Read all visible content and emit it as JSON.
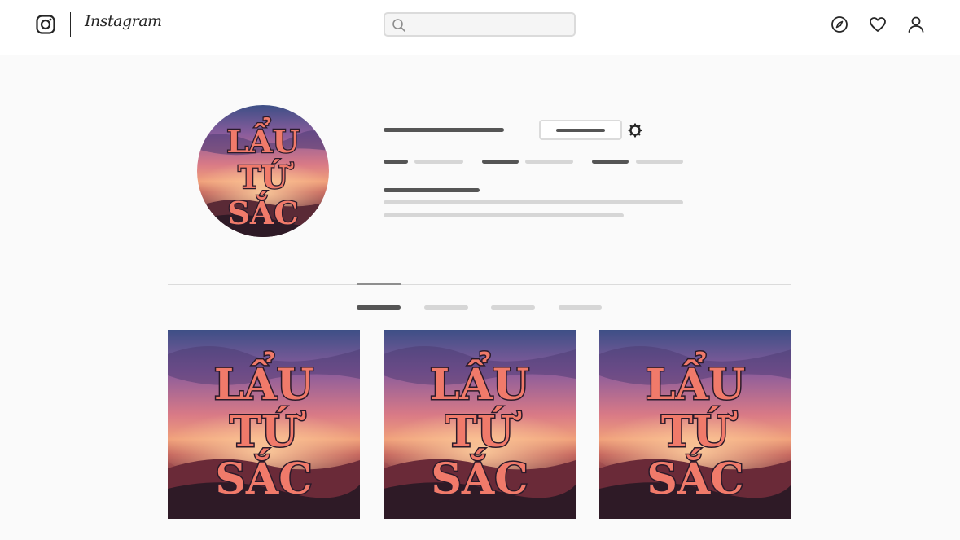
{
  "app": {
    "name": "Instagram"
  },
  "header": {
    "wordmark": "Instagram",
    "search": {
      "value": "",
      "placeholder": ""
    },
    "icons": [
      "compass-icon",
      "heart-icon",
      "user-icon"
    ]
  },
  "profile": {
    "avatar": {
      "caption_lines": [
        "LẨU",
        "TỨ",
        "SẮC"
      ]
    }
  },
  "posts": [
    {
      "caption_lines": [
        "LẨU",
        "TỨ",
        "SẮC"
      ]
    },
    {
      "caption_lines": [
        "LẨU",
        "TỨ",
        "SẮC"
      ]
    },
    {
      "caption_lines": [
        "LẨU",
        "TỨ",
        "SẮC"
      ]
    }
  ],
  "colors": {
    "header_bg": "#ffffff",
    "page_bg": "#fafafa",
    "skeleton_dark": "#555555",
    "skeleton_light": "#d6d6d6",
    "caption_text": "#f07a6a",
    "caption_outline": "#2a1a2a"
  }
}
